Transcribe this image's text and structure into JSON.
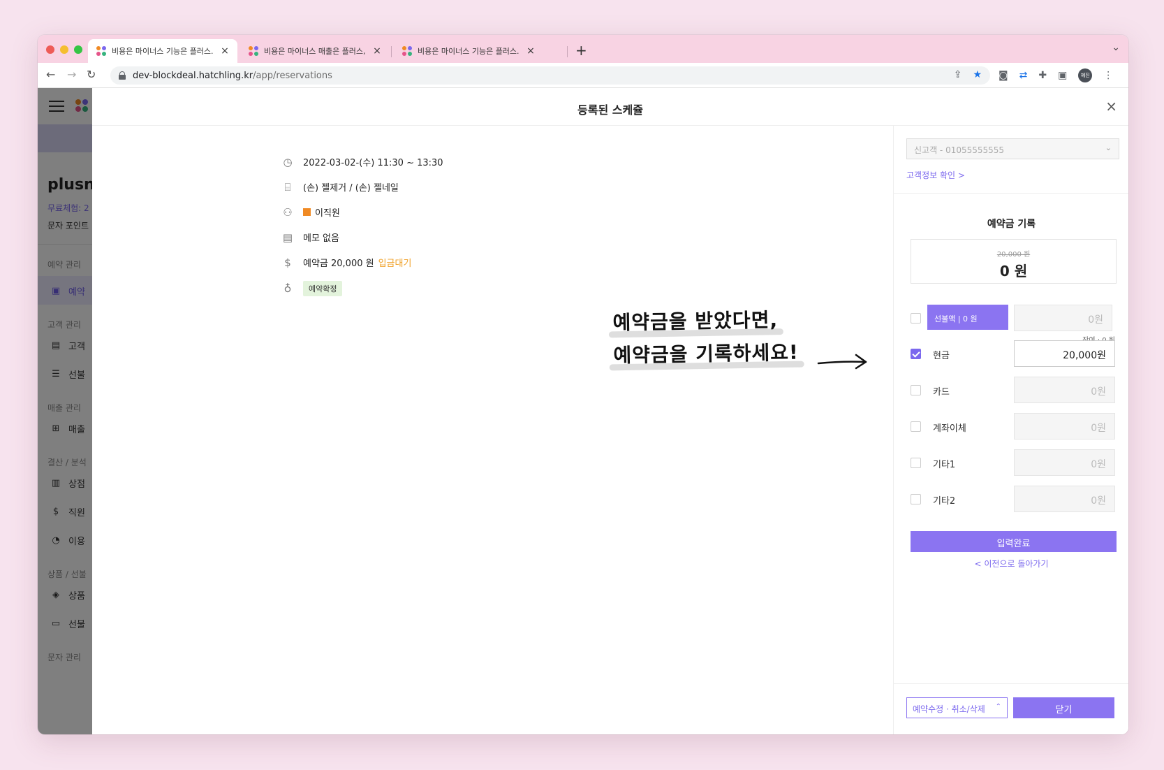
{
  "browser": {
    "tabs": [
      {
        "title": "비용은 마이너스 기능은 플러스. 플리",
        "close": "×"
      },
      {
        "title": "비용은 마이너스 매출은 플러스, 플리",
        "close": "×"
      },
      {
        "title": "비용은 마이너스 기능은 플러스. 플리",
        "close": "×"
      }
    ],
    "new_tab": "+",
    "tab_menu": "⌄",
    "url_host": "dev-blockdeal.hatchling.kr",
    "url_path": "/app/reservations",
    "profile_initials": "혜진"
  },
  "sidebar": {
    "brand": "plusnail",
    "trial": "무료체험: 2",
    "points": "문자 포인트",
    "sections": [
      {
        "title": "예약 관리",
        "items": [
          {
            "icon": "calendar-icon",
            "label": "예약"
          }
        ]
      },
      {
        "title": "고객 관리",
        "items": [
          {
            "icon": "document-icon",
            "label": "고객"
          },
          {
            "icon": "database-icon",
            "label": "선불"
          }
        ]
      },
      {
        "title": "매출 관리",
        "items": [
          {
            "icon": "add-file-icon",
            "label": "매출"
          }
        ]
      },
      {
        "title": "결산 / 분석",
        "items": [
          {
            "icon": "bar-chart-icon",
            "label": "상점"
          },
          {
            "icon": "dollar-icon",
            "label": "직원"
          },
          {
            "icon": "pie-chart-icon",
            "label": "이용"
          }
        ]
      },
      {
        "title": "상품 / 선불",
        "items": [
          {
            "icon": "box-icon",
            "label": "상품"
          },
          {
            "icon": "ticket-icon",
            "label": "선불"
          }
        ]
      },
      {
        "title": "문자 관리",
        "items": []
      }
    ]
  },
  "modal": {
    "title": "등록된 스케쥴",
    "close": "×",
    "details": {
      "datetime": "2022-03-02-(수) 11:30 ~ 13:30",
      "service": "(손) 젤제거 / (손) 젤네일",
      "staff": "이직원",
      "memo": "메모 없음",
      "deposit_text": "예약금 20,000 원",
      "deposit_status": "입금대기",
      "badge": "예약확정"
    },
    "annotation": {
      "line1": "예약금을 받았다면,",
      "line2": "예약금을 기록하세요!"
    },
    "panel": {
      "customer_select": "신고객 - 01055555555",
      "customer_link": "고객정보 확인 >",
      "deposit_title": "예약금 기록",
      "deposit_original": "20,000 원",
      "deposit_amount": "0 원",
      "prepaid_label": "선불액 | 0 원",
      "prepaid_value": "0원",
      "prepaid_remaining": "잔여 : 0 원",
      "payments": [
        {
          "label": "현금",
          "value": "20,000원",
          "checked": true
        },
        {
          "label": "카드",
          "value": "0원",
          "checked": false
        },
        {
          "label": "계좌이체",
          "value": "0원",
          "checked": false
        },
        {
          "label": "기타1",
          "value": "0원",
          "checked": false
        },
        {
          "label": "기타2",
          "value": "0원",
          "checked": false
        }
      ],
      "submit": "입력완료",
      "back": "< 이전으로 돌아가기",
      "edit": "예약수정 · 취소/삭제",
      "close": "닫기"
    }
  },
  "colors": {
    "accent": "#8b74f1",
    "link": "#7b68ee",
    "status_wait": "#f0a22a",
    "staff_swatch": "#f08a24",
    "tab_bar": "#f8d3e3"
  }
}
